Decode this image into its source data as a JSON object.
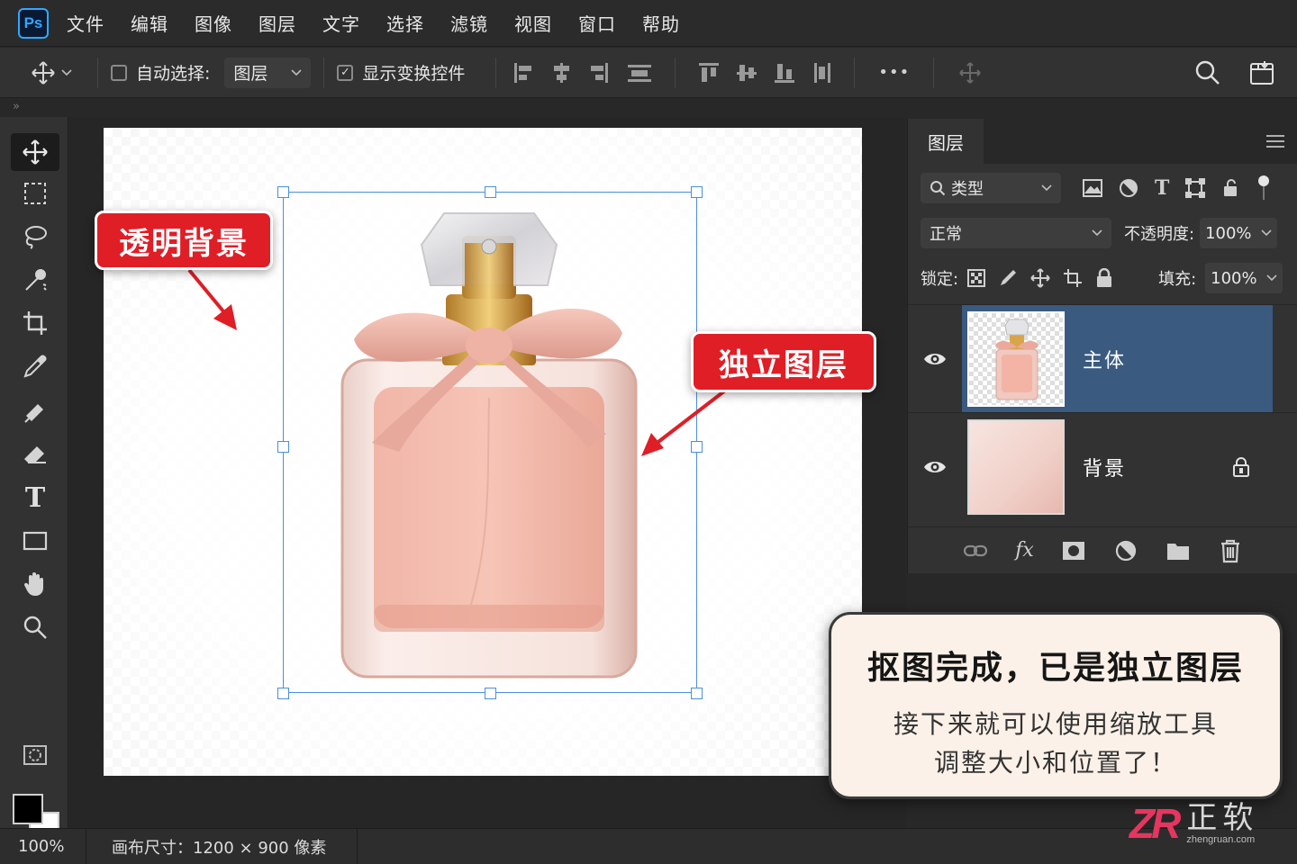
{
  "app": {
    "logo": "Ps"
  },
  "menu": [
    "文件",
    "编辑",
    "图像",
    "图层",
    "文字",
    "选择",
    "滤镜",
    "视图",
    "窗口",
    "帮助"
  ],
  "options": {
    "auto_select_label": "自动选择:",
    "auto_select_target": "图层",
    "show_transform_label": "显示变换控件",
    "more": "•••"
  },
  "canvas": {
    "callout_transparent": "透明背景",
    "callout_layer": "独立图层"
  },
  "layers_panel": {
    "tab": "图层",
    "filter_label": "类型",
    "blend_mode": "正常",
    "opacity_label": "不透明度:",
    "opacity_value": "100%",
    "lock_label": "锁定:",
    "fill_label": "填充:",
    "fill_value": "100%",
    "layers": [
      {
        "name": "主体",
        "selected": true,
        "locked": false
      },
      {
        "name": "背景",
        "selected": false,
        "locked": true
      }
    ]
  },
  "info_card": {
    "title": "抠图完成，已是独立图层",
    "line1": "接下来就可以使用缩放工具",
    "line2": "调整大小和位置了！"
  },
  "status": {
    "zoom": "100%",
    "doc_info": "画布尺寸：1200 × 900 像素"
  },
  "brand": {
    "logo": "ZR",
    "name": "正软",
    "url": "zhengruan.com"
  },
  "colors": {
    "accent_blue": "#31a8ff",
    "selection_blue": "#3a5a80",
    "callout_red": "#e01e26",
    "bbox_blue": "#4a8fe0"
  }
}
